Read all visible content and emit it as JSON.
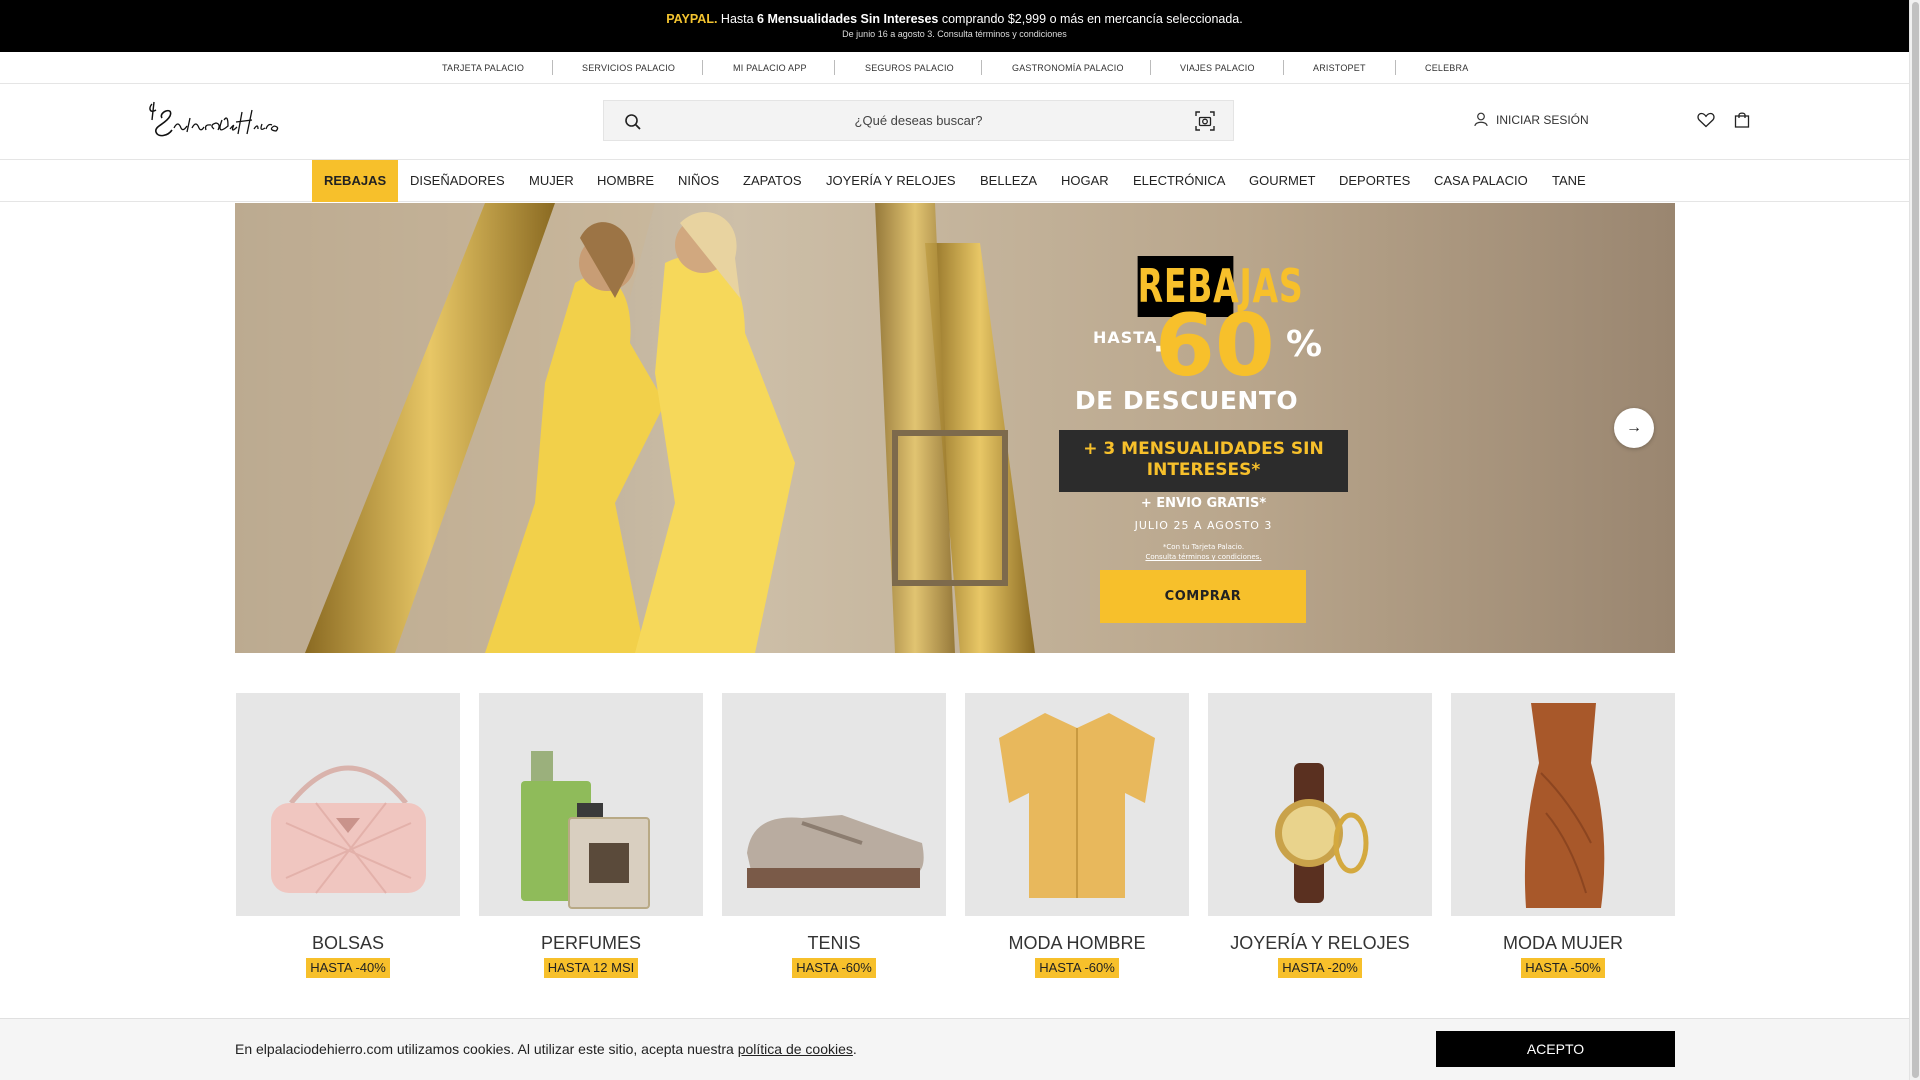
{
  "promo": {
    "brand": "PAYPAL.",
    "text_a": " Hasta ",
    "bold": "6 Mensualidades Sin Intereses",
    "text_b": " comprando $2,999 o más en mercancía seleccionada.",
    "sub": "De junio 16 a agosto 3. Consulta términos y condiciones"
  },
  "services": [
    "Tarjeta Palacio",
    "Servicios Palacio",
    "Mi Palacio App",
    "Seguros Palacio",
    "Gastronomía Palacio",
    "Viajes Palacio",
    "Aristopet",
    "Celebra"
  ],
  "header": {
    "logo_alt": "El Palacio de Hierro",
    "search_placeholder": "¿Qué deseas buscar?",
    "login": "INICIAR SESIÓN"
  },
  "nav": [
    "REBAJAS",
    "DISEÑADORES",
    "MUJER",
    "HOMBRE",
    "NIÑOS",
    "ZAPATOS",
    "JOYERÍA Y RELOJES",
    "BELLEZA",
    "HOGAR",
    "ELECTRÓNICA",
    "GOURMET",
    "DEPORTES",
    "CASA PALACIO",
    "TANE"
  ],
  "hero": {
    "title": "REBAJAS",
    "hasta": "HASTA",
    "dash": "-",
    "value": "60",
    "pct": "%",
    "desc": "DE DESCUENTO",
    "msi_1": "+ 3 MENSUALIDADES SIN",
    "msi_2": "INTERESES*",
    "envio": "+ ENVIO GRATIS*",
    "fechas": "JULIO 25 A AGOSTO 3",
    "note_1": "*Con tu Tarjeta Palacio.",
    "note_2": "Consulta términos y condiciones.",
    "cta": "COMPRAR",
    "next": "→"
  },
  "categories": [
    {
      "name": "BOLSAS",
      "badge": "HASTA -40%"
    },
    {
      "name": "PERFUMES",
      "badge": "HASTA 12 MSI"
    },
    {
      "name": "TENIS",
      "badge": "HASTA -60%"
    },
    {
      "name": "MODA HOMBRE",
      "badge": "HASTA -60%"
    },
    {
      "name": "JOYERÍA Y RELOJES",
      "badge": "HASTA -20%"
    },
    {
      "name": "MODA MUJER",
      "badge": "HASTA -50%"
    }
  ],
  "cookie": {
    "text": "En elpalaciodehierro.com utilizamos cookies. Al utilizar este sitio, acepta nuestra ",
    "link": "política de cookies",
    "end": ".",
    "accept": "ACEPTO"
  },
  "colors": {
    "accent": "#f7c02b",
    "promo_bg": "#000000",
    "text": "#222222"
  }
}
